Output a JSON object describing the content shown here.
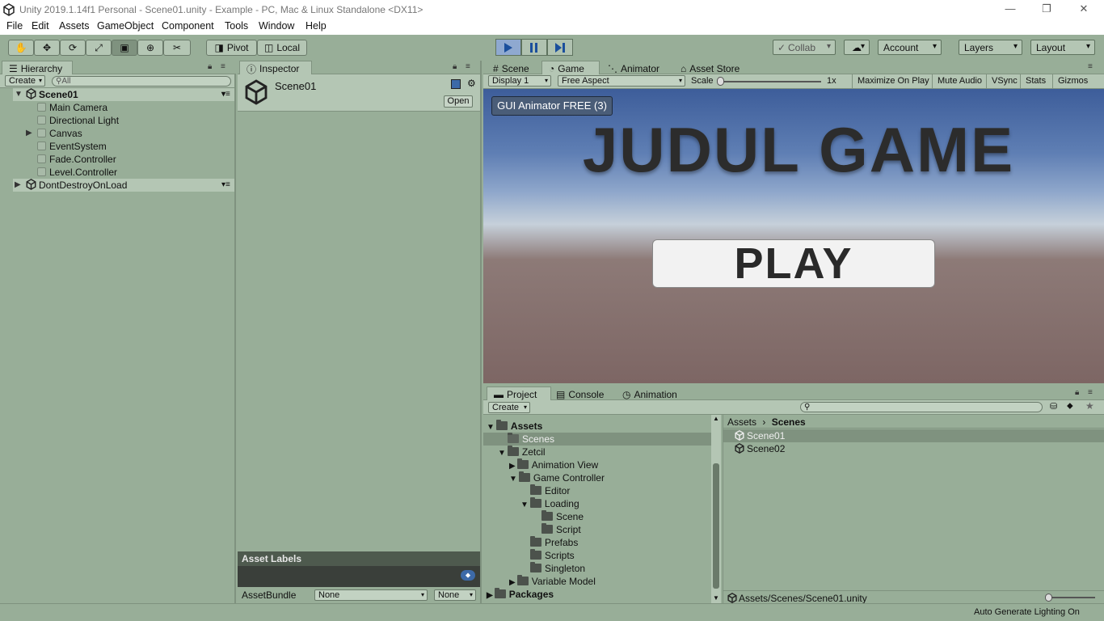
{
  "window": {
    "title": "Unity 2019.1.14f1 Personal - Scene01.unity - Example - PC, Mac & Linux Standalone <DX11>",
    "minimize": "—",
    "restore": "❐",
    "close": "✕"
  },
  "menu": [
    "File",
    "Edit",
    "Assets",
    "GameObject",
    "Component",
    "Tools",
    "Window",
    "Help"
  ],
  "toolbar": {
    "pivot": "Pivot",
    "local": "Local",
    "collab": "Collab",
    "account": "Account",
    "layers": "Layers",
    "layout": "Layout"
  },
  "hierarchy": {
    "tab": "Hierarchy",
    "create": "Create",
    "search_placeholder": "All",
    "scene": "Scene01",
    "items": [
      "Main Camera",
      "Directional Light",
      "Canvas",
      "EventSystem",
      "Fade.Controller",
      "Level.Controller"
    ],
    "dontdestroy": "DontDestroyOnLoad"
  },
  "inspector": {
    "tab": "Inspector",
    "object_name": "Scene01",
    "open_button": "Open",
    "asset_labels": "Asset Labels",
    "assetbundle_label": "AssetBundle",
    "assetbundle_value": "None",
    "variant_value": "None"
  },
  "view_tabs": [
    "Scene",
    "Game",
    "Animator",
    "Asset Store"
  ],
  "game_bar": {
    "display": "Display 1",
    "aspect": "Free Aspect",
    "scale_label": "Scale",
    "scale_value": "1x",
    "maximize": "Maximize On Play",
    "mute": "Mute Audio",
    "vsync": "VSync",
    "stats": "Stats",
    "gizmos": "Gizmos"
  },
  "game": {
    "gui_animator": "GUI Animator FREE (3)",
    "title": "JUDUL GAME",
    "play_button": "PLAY"
  },
  "bottom_tabs": [
    "Project",
    "Console",
    "Animation"
  ],
  "project": {
    "create": "Create",
    "tree": {
      "assets": "Assets",
      "scenes": "Scenes",
      "zetcil": "Zetcil",
      "animation_view": "Animation View",
      "game_controller": "Game Controller",
      "editor": "Editor",
      "loading": "Loading",
      "scene": "Scene",
      "script": "Script",
      "prefabs": "Prefabs",
      "scripts": "Scripts",
      "singleton": "Singleton",
      "variable_model": "Variable Model",
      "packages": "Packages"
    },
    "breadcrumb_root": "Assets",
    "breadcrumb_sep": "›",
    "breadcrumb_current": "Scenes",
    "files": [
      "Scene01",
      "Scene02"
    ],
    "path": "Assets/Scenes/Scene01.unity"
  },
  "status": {
    "right": "Auto Generate Lighting On"
  }
}
